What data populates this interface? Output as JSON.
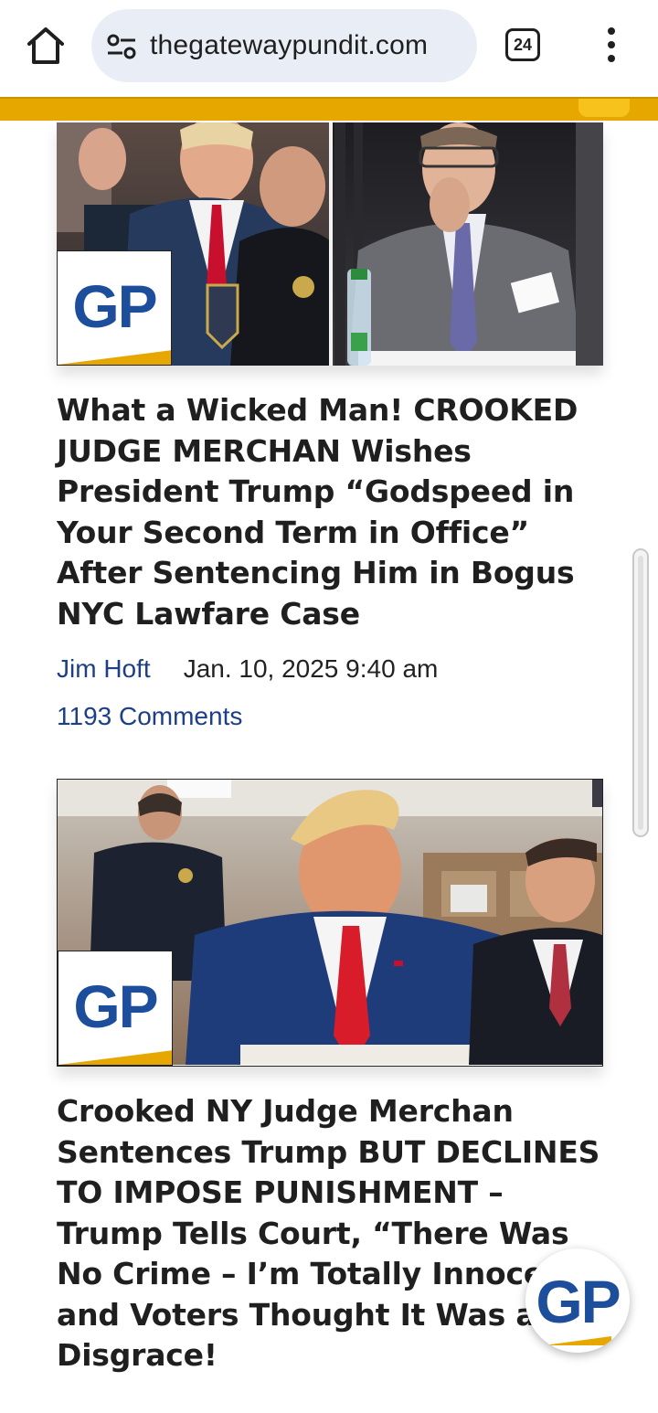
{
  "browser": {
    "url": "thegatewaypundit.com",
    "tab_count": "24"
  },
  "brand": {
    "logo_text": "GP",
    "primary_color": "#1c4e9c",
    "accent_color": "#e6a800"
  },
  "articles": [
    {
      "headline": "What a Wicked Man! CROOKED JUDGE MERCHAN Wishes President Trump “Godspeed in Your Second Term in Office” After Sentencing Him in Bogus NYC Lawfare Case",
      "author": "Jim Hoft",
      "date": "Jan. 10, 2025 9:40 am",
      "comments": "1193 Comments",
      "image": "courtroom-photo-diptych"
    },
    {
      "headline": "Crooked NY Judge Merchan Sentences Trump BUT DECLINES TO IMPOSE PUNISHMENT – Trump Tells Court, “There Was No Crime – I’m Totally Innocent” and Voters Thought It Was a Disgrace!",
      "image": "courtroom-photo"
    }
  ]
}
